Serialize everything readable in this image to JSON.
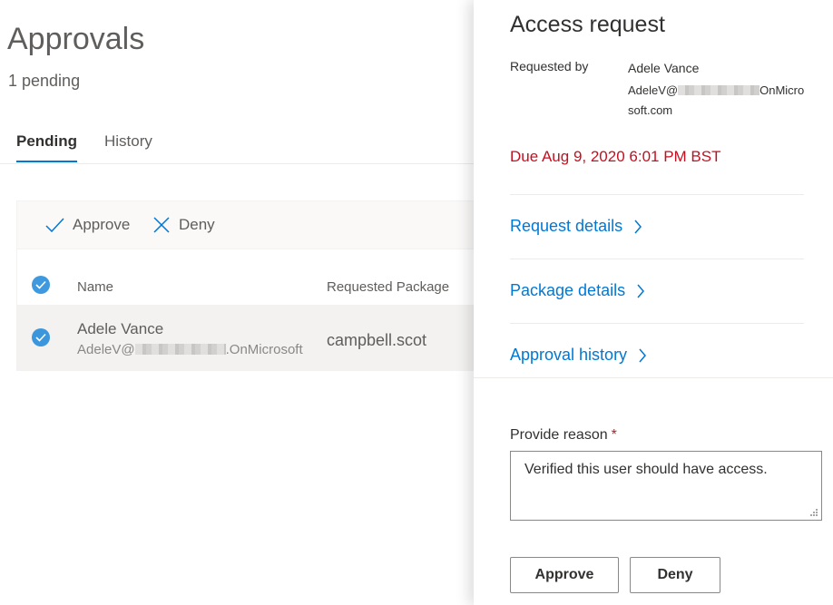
{
  "page": {
    "title": "Approvals",
    "pending_count": "1 pending"
  },
  "tabs": [
    {
      "label": "Pending",
      "active": true
    },
    {
      "label": "History",
      "active": false
    }
  ],
  "commands": {
    "approve": "Approve",
    "deny": "Deny"
  },
  "table": {
    "columns": [
      "Name",
      "Requested Package"
    ],
    "rows": [
      {
        "name": "Adele Vance",
        "email_prefix": "AdeleV@",
        "email_suffix": ".OnMicrosoft",
        "package": "campbell.scot",
        "selected": true
      }
    ]
  },
  "panel": {
    "title": "Access request",
    "requested_by_label": "Requested by",
    "requester_name": "Adele Vance",
    "requester_email_prefix": "AdeleV@",
    "requester_email_suffix": "OnMicrosoft.com",
    "due": "Due Aug 9, 2020 6:01 PM BST",
    "links": {
      "request_details": "Request details",
      "package_details": "Package details",
      "approval_history": "Approval history"
    },
    "reason_label": "Provide reason",
    "required_marker": "*",
    "reason_value": "Verified this user should have access.",
    "approve_button": "Approve",
    "deny_button": "Deny"
  },
  "colors": {
    "accent": "#0078d4",
    "due_red": "#c50f1f",
    "required_red": "#a4262c"
  },
  "icons": {
    "approve": "checkmark-icon",
    "deny": "cancel-icon",
    "chevron": "chevron-right-icon"
  }
}
